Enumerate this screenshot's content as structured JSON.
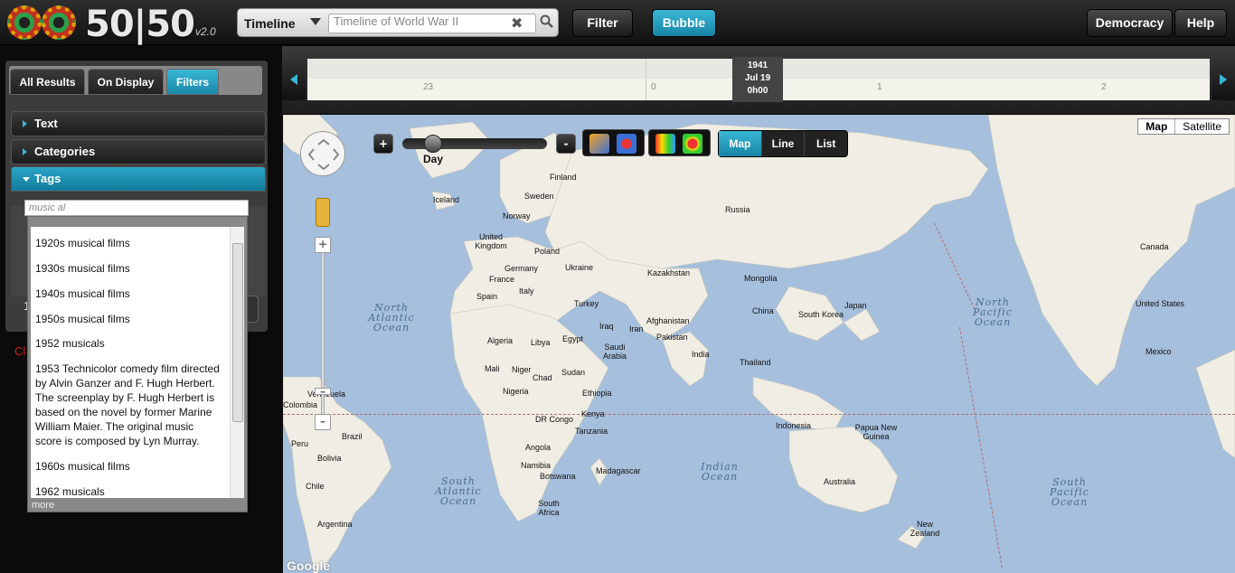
{
  "app": {
    "logo_text": "50|50",
    "version": "v2.0"
  },
  "search": {
    "mode": "Timeline",
    "value": "Timeline of World War II"
  },
  "toolbar": {
    "filter_label": "Filter",
    "bubble_label": "Bubble",
    "democracy_label": "Democracy",
    "help_label": "Help"
  },
  "sidebar": {
    "tabs": [
      {
        "label": "All Results"
      },
      {
        "label": "On Display"
      },
      {
        "label": "Filters"
      }
    ],
    "sections": [
      {
        "label": "Text"
      },
      {
        "label": "Categories"
      },
      {
        "label": "Tags"
      }
    ],
    "tag_input": "music al",
    "partial_red": "Cl",
    "partial_num": "1"
  },
  "dropdown": {
    "items": [
      {
        "label": "1920s musical films"
      },
      {
        "label": "1930s musical films"
      },
      {
        "label": "1940s musical films"
      },
      {
        "label": "1950s musical films"
      },
      {
        "label": "1952 musicals"
      },
      {
        "label": "1953 Technicolor comedy film directed by Alvin Ganzer and F. Hugh Herbert. The screenplay by F. Hugh Herbert is based on the novel by former Marine William Maier. The original music score is composed by Lyn Murray."
      },
      {
        "label": "1960s musical films"
      },
      {
        "label": "1962 musicals"
      }
    ],
    "more": "more"
  },
  "timeline": {
    "ticks": [
      {
        "label": "23"
      },
      {
        "label": "0"
      },
      {
        "label": "1"
      },
      {
        "label": "2"
      }
    ],
    "marker": {
      "year": "1941",
      "date": "Jul 19",
      "time": "0h00"
    }
  },
  "map": {
    "type_options": [
      {
        "label": "Map"
      },
      {
        "label": "Satellite"
      }
    ],
    "scale_label": "Day",
    "plus": "+",
    "minus": "-",
    "view_modes": [
      {
        "label": "Map"
      },
      {
        "label": "Line"
      },
      {
        "label": "List"
      }
    ],
    "countries": [
      "Iceland",
      "Finland",
      "Sweden",
      "Norway",
      "Russia",
      "United Kingdom",
      "Poland",
      "Germany",
      "Ukraine",
      "France",
      "Italy",
      "Spain",
      "Kazakhstan",
      "Mongolia",
      "Turkey",
      "China",
      "Japan",
      "South Korea",
      "Iraq",
      "Iran",
      "Afghanistan",
      "Pakistan",
      "India",
      "Thailand",
      "Algeria",
      "Libya",
      "Egypt",
      "Saudi Arabia",
      "Mali",
      "Niger",
      "Chad",
      "Sudan",
      "Nigeria",
      "Ethiopia",
      "Kenya",
      "DR Congo",
      "Tanzania",
      "Angola",
      "Namibia",
      "Botswana",
      "Madagascar",
      "South Africa",
      "Indonesia",
      "Papua New Guinea",
      "Australia",
      "New Zealand",
      "Canada",
      "United States",
      "Mexico",
      "Colombia",
      "Venezuela",
      "Peru",
      "Brazil",
      "Bolivia",
      "Chile",
      "Argentina"
    ],
    "oceans": {
      "north_atlantic": "North Atlantic Ocean",
      "north_pacific": "North Pacific Ocean",
      "south_atlantic": "South Atlantic Ocean",
      "indian": "Indian Ocean",
      "south_pacific": "South Pacific Ocean"
    },
    "google": "Google"
  }
}
